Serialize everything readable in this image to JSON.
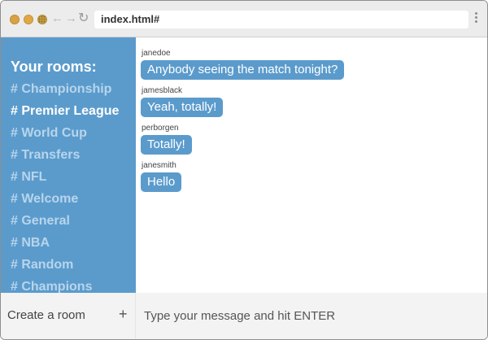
{
  "browser": {
    "url": "index.html#"
  },
  "sidebar": {
    "title": "Your rooms:",
    "rooms": [
      {
        "label": "# Championship",
        "active": false
      },
      {
        "label": "# Premier League",
        "active": true
      },
      {
        "label": "# World Cup",
        "active": false
      },
      {
        "label": "# Transfers",
        "active": false
      },
      {
        "label": "# NFL",
        "active": false
      },
      {
        "label": "# Welcome",
        "active": false
      },
      {
        "label": "# General",
        "active": false
      },
      {
        "label": "# NBA",
        "active": false
      },
      {
        "label": "# Random",
        "active": false
      },
      {
        "label": "# Champions",
        "active": false
      }
    ],
    "create_room_label": "Create a room",
    "create_room_icon": "+"
  },
  "messages": [
    {
      "user": "janedoe",
      "text": "Anybody seeing the match tonight?"
    },
    {
      "user": "jamesblack",
      "text": "Yeah, totally!"
    },
    {
      "user": "perborgen",
      "text": "Totally!"
    },
    {
      "user": "janesmith",
      "text": "Hello"
    }
  ],
  "composer": {
    "placeholder": "Type your message and hit ENTER"
  },
  "colors": {
    "accent": "#5b9bcc",
    "room_inactive": "#b7d5ec",
    "room_active": "#ffffff"
  }
}
